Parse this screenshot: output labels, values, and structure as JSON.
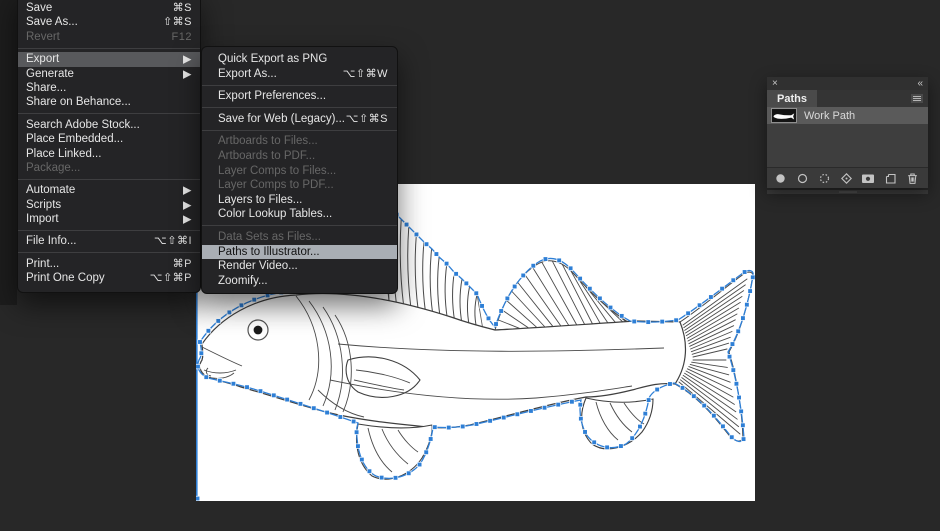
{
  "ui": {
    "submenu_arrow": "▶"
  },
  "colors": {
    "workspace_bg": "#282828",
    "left_strip": "#1d1d1d",
    "canvas_bg": "#ffffff",
    "menu_bg": "#242426",
    "menu_text": "#e6e6e6",
    "menu_disabled": "#676767",
    "menu_highlight": "#58595c",
    "submenu_hover_bg": "#a9aeb4",
    "submenu_hover_text": "#121212",
    "separator": "#3e3e40",
    "path_blue": "#2e7fd6",
    "ink": "#3f3f3f",
    "hatch": "#4a4a4a",
    "panel_bg": "#3e3e3e",
    "panel_header": "#303030",
    "panel_tabbar": "#343434",
    "panel_tab_active": "#4a4a4a",
    "panel_row_selected": "#5a5a5a",
    "panel_footer": "#3a3a3a",
    "panel_text": "#d9d9d9",
    "icon_gray": "#c3c3c3"
  },
  "file_menu": {
    "items": [
      {
        "label": "Save",
        "shortcut": "⌘S",
        "state": "normal"
      },
      {
        "label": "Save As...",
        "shortcut": "⇧⌘S",
        "state": "normal"
      },
      {
        "label": "Revert",
        "shortcut": "F12",
        "state": "disabled"
      },
      {
        "label": "Export",
        "state": "open",
        "has_submenu": true
      },
      {
        "label": "Generate",
        "state": "normal",
        "has_submenu": true
      },
      {
        "label": "Share...",
        "state": "normal"
      },
      {
        "label": "Share on Behance...",
        "state": "normal"
      },
      {
        "label": "Search Adobe Stock...",
        "state": "normal"
      },
      {
        "label": "Place Embedded...",
        "state": "normal"
      },
      {
        "label": "Place Linked...",
        "state": "normal"
      },
      {
        "label": "Package...",
        "state": "disabled"
      },
      {
        "label": "Automate",
        "state": "normal",
        "has_submenu": true
      },
      {
        "label": "Scripts",
        "state": "normal",
        "has_submenu": true
      },
      {
        "label": "Import",
        "state": "normal",
        "has_submenu": true
      },
      {
        "label": "File Info...",
        "shortcut": "⌥⇧⌘I",
        "state": "normal"
      },
      {
        "label": "Print...",
        "shortcut": "⌘P",
        "state": "normal"
      },
      {
        "label": "Print One Copy",
        "shortcut": "⌥⇧⌘P",
        "state": "normal"
      }
    ]
  },
  "export_submenu": {
    "items": [
      {
        "label": "Quick Export as PNG",
        "state": "normal"
      },
      {
        "label": "Export As...",
        "shortcut": "⌥⇧⌘W",
        "state": "normal"
      },
      {
        "label": "Export Preferences...",
        "state": "normal"
      },
      {
        "label": "Save for Web (Legacy)...",
        "shortcut": "⌥⇧⌘S",
        "state": "normal"
      },
      {
        "label": "Artboards to Files...",
        "state": "disabled"
      },
      {
        "label": "Artboards to PDF...",
        "state": "disabled"
      },
      {
        "label": "Layer Comps to Files...",
        "state": "disabled"
      },
      {
        "label": "Layer Comps to PDF...",
        "state": "disabled"
      },
      {
        "label": "Layers to Files...",
        "state": "normal"
      },
      {
        "label": "Color Lookup Tables...",
        "state": "normal"
      },
      {
        "label": "Data Sets as Files...",
        "state": "disabled"
      },
      {
        "label": "Paths to Illustrator...",
        "state": "hover"
      },
      {
        "label": "Render Video...",
        "state": "normal"
      },
      {
        "label": "Zoomify...",
        "state": "normal"
      }
    ]
  },
  "paths_panel": {
    "close_icon": "×",
    "collapse_icon": "«",
    "tab_label": "Paths",
    "rows": [
      {
        "label": "Work Path",
        "selected": true
      }
    ],
    "footer_icons": [
      "fill-path",
      "stroke-path",
      "load-path-as-selection",
      "make-work-path",
      "add-mask",
      "create-new-path",
      "delete-path"
    ]
  }
}
